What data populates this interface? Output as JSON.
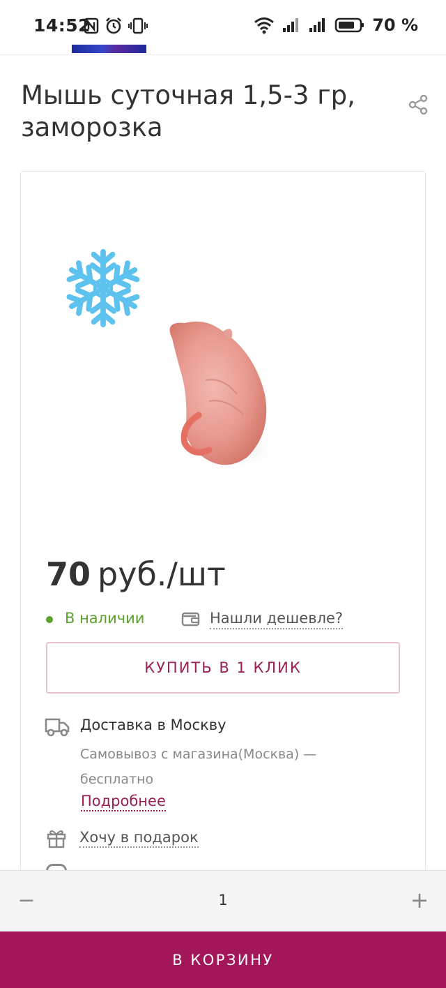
{
  "status_bar": {
    "time": "14:52",
    "battery_percent": "70 %",
    "icons": [
      "nfc-icon",
      "alarm-icon",
      "vibrate-icon",
      "wifi-icon",
      "signal-icon",
      "signal-icon",
      "battery-icon"
    ]
  },
  "product": {
    "title": "Мышь суточная 1,5-3 гр, заморозка",
    "price_value": "70",
    "price_unit": "руб./шт",
    "stock_status": "В наличии",
    "cheaper_link": "Нашли дешевле?",
    "buy_one_click": "КУПИТЬ В 1 КЛИК"
  },
  "delivery": {
    "title": "Доставка в Москву",
    "description": "Самовывоз с магазина(Москва)  —  бесплатно",
    "more_link": "Подробнее"
  },
  "gift": {
    "label": "Хочу в подарок"
  },
  "quantity": {
    "minus": "−",
    "value": "1",
    "plus": "+"
  },
  "cart_button": "В КОРЗИНУ",
  "colors": {
    "accent": "#a4165a",
    "stock_green": "#5aa02c",
    "snowflake": "#5ec2ef"
  }
}
